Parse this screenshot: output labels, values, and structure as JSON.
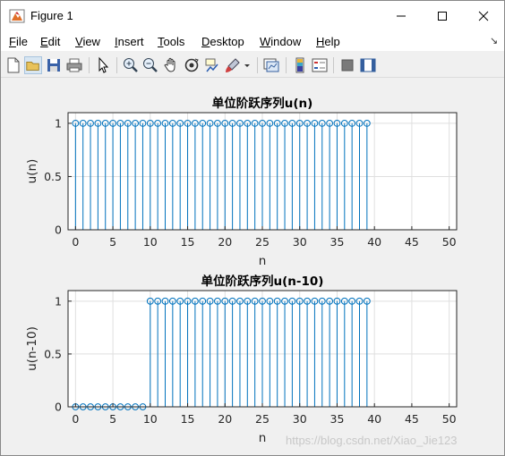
{
  "window": {
    "title": "Figure 1",
    "icon": "matlab-figure-icon"
  },
  "menu": [
    {
      "key": "file",
      "pre": "",
      "u": "F",
      "post": "ile"
    },
    {
      "key": "edit",
      "pre": "",
      "u": "E",
      "post": "dit"
    },
    {
      "key": "view",
      "pre": "",
      "u": "V",
      "post": "iew"
    },
    {
      "key": "insert",
      "pre": "",
      "u": "I",
      "post": "nsert"
    },
    {
      "key": "tools",
      "pre": "",
      "u": "T",
      "post": "ools"
    },
    {
      "key": "desktop",
      "pre": "",
      "u": "D",
      "post": "esktop"
    },
    {
      "key": "window",
      "pre": "",
      "u": "W",
      "post": "indow"
    },
    {
      "key": "help",
      "pre": "",
      "u": "H",
      "post": "elp"
    }
  ],
  "toolbar": [
    "new-figure-icon",
    "open-file-icon",
    "save-icon",
    "print-icon",
    "pointer-icon",
    "zoom-in-icon",
    "zoom-out-icon",
    "pan-icon",
    "rotate-3d-icon",
    "data-cursor-icon",
    "brush-icon",
    "brush-dropdown-icon",
    "link-plot-icon",
    "insert-colorbar-icon",
    "insert-legend-icon",
    "hide-plot-tools-icon",
    "show-plot-tools-icon"
  ],
  "colors": {
    "stem": "#0072bd",
    "grid": "#dfdfdf",
    "axes_bg": "#ffffff",
    "figure_bg": "#f0f0f0"
  },
  "chart_data": [
    {
      "type": "stem",
      "title": "单位阶跃序列u(n)",
      "xlabel": "n",
      "ylabel": "u(n)",
      "xlim": [
        -1,
        51
      ],
      "ylim": [
        0,
        1.1
      ],
      "xticks": [
        0,
        5,
        10,
        15,
        20,
        25,
        30,
        35,
        40,
        45,
        50
      ],
      "yticks": [
        0,
        0.5,
        1
      ],
      "grid": true,
      "x": [
        0,
        1,
        2,
        3,
        4,
        5,
        6,
        7,
        8,
        9,
        10,
        11,
        12,
        13,
        14,
        15,
        16,
        17,
        18,
        19,
        20,
        21,
        22,
        23,
        24,
        25,
        26,
        27,
        28,
        29,
        30,
        31,
        32,
        33,
        34,
        35,
        36,
        37,
        38,
        39
      ],
      "y": [
        1,
        1,
        1,
        1,
        1,
        1,
        1,
        1,
        1,
        1,
        1,
        1,
        1,
        1,
        1,
        1,
        1,
        1,
        1,
        1,
        1,
        1,
        1,
        1,
        1,
        1,
        1,
        1,
        1,
        1,
        1,
        1,
        1,
        1,
        1,
        1,
        1,
        1,
        1,
        1
      ]
    },
    {
      "type": "stem",
      "title": "单位阶跃序列u(n-10)",
      "xlabel": "n",
      "ylabel": "u(n-10)",
      "xlim": [
        -1,
        51
      ],
      "ylim": [
        0,
        1.1
      ],
      "xticks": [
        0,
        5,
        10,
        15,
        20,
        25,
        30,
        35,
        40,
        45,
        50
      ],
      "yticks": [
        0,
        0.5,
        1
      ],
      "grid": true,
      "x": [
        0,
        1,
        2,
        3,
        4,
        5,
        6,
        7,
        8,
        9,
        10,
        11,
        12,
        13,
        14,
        15,
        16,
        17,
        18,
        19,
        20,
        21,
        22,
        23,
        24,
        25,
        26,
        27,
        28,
        29,
        30,
        31,
        32,
        33,
        34,
        35,
        36,
        37,
        38,
        39
      ],
      "y": [
        0,
        0,
        0,
        0,
        0,
        0,
        0,
        0,
        0,
        0,
        1,
        1,
        1,
        1,
        1,
        1,
        1,
        1,
        1,
        1,
        1,
        1,
        1,
        1,
        1,
        1,
        1,
        1,
        1,
        1,
        1,
        1,
        1,
        1,
        1,
        1,
        1,
        1,
        1,
        1
      ]
    }
  ],
  "watermark": "https://blog.csdn.net/Xiao_Jie123"
}
